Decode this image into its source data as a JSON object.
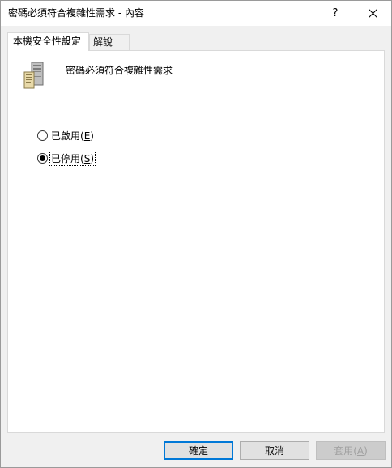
{
  "window": {
    "title": "密碼必須符合複雜性需求 - 內容",
    "help_label": "?"
  },
  "tabs": [
    {
      "label": "本機安全性設定",
      "active": true
    },
    {
      "label": "解說",
      "active": false
    }
  ],
  "policy": {
    "icon": "server-icon",
    "title": "密碼必須符合複雜性需求"
  },
  "options": [
    {
      "label": "已啟用(",
      "mnemonic": "E",
      "suffix": ")",
      "checked": false
    },
    {
      "label": "已停用(",
      "mnemonic": "S",
      "suffix": ")",
      "checked": true
    }
  ],
  "buttons": {
    "ok": "確定",
    "cancel": "取消",
    "apply_label": "套用(",
    "apply_mnemonic": "A",
    "apply_suffix": ")"
  },
  "colors": {
    "accent": "#0078d7",
    "panel": "#ffffff",
    "background": "#f0f0f0"
  }
}
